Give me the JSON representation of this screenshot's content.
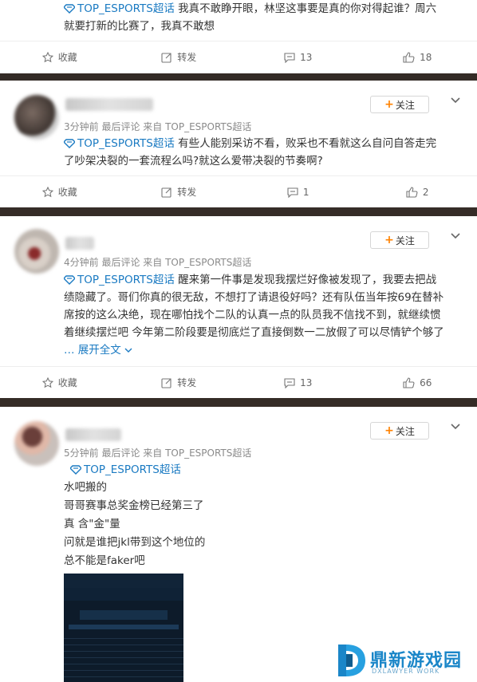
{
  "topic": "TOP_ESPORTS超话",
  "actions": {
    "favorite": "收藏",
    "repost": "转发"
  },
  "follow_label": "关注",
  "post0": {
    "text_line1": "我真不敢睁开眼，林坚这事要是真的你对得起谁？周六",
    "text_line2": "就要打新的比赛了，我真不敢想",
    "comments": "13",
    "likes": "18"
  },
  "post1": {
    "meta": "3分钟前 最后评论 来自 TOP_ESPORTS超话",
    "text_line1": "有些人能别采访不看，败采也不看就这么自问自答走完",
    "text_line2": "了吵架决裂的一套流程么吗?就这么爱带决裂的节奏啊?",
    "comments": "1",
    "likes": "2"
  },
  "post2": {
    "meta": "4分钟前 最后评论 来自 TOP_ESPORTS超话",
    "text_line1": "醒来第一件事是发现我摆烂好像被发现了，我要去把战",
    "text_line2": "绩隐藏了。哥们你真的很无敌，不想打了请退役好吗？还有队伍当年按69在替补",
    "text_line3": "席按的这么决绝，现在哪怕找个二队的认真一点的队员我不信找不到，就继续惯",
    "text_line4": "着继续摆烂吧 今年第二阶段要是彻底烂了直接倒数一二放假了可以尽情铲个够了",
    "expand": "展开全文",
    "comments": "13",
    "likes": "66"
  },
  "post3": {
    "meta": "5分钟前 最后评论 来自 TOP_ESPORTS超话",
    "lines": [
      "水吧搬的",
      "哥哥赛事总奖金榜已经第三了",
      "真 含\"金\"量",
      "问就是谁把jkl带到这个地位的",
      "总不能是faker吧"
    ]
  },
  "watermark": {
    "title": "鼎新游戏园",
    "subtitle": "DXLAWYER WORK"
  },
  "colors": {
    "accent": "#ff8200",
    "link": "#1a7ac2"
  }
}
